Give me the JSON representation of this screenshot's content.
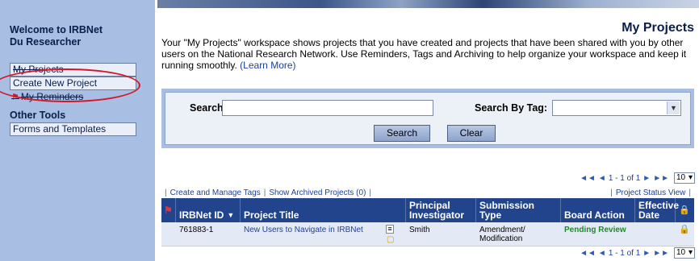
{
  "sidebar": {
    "welcome_line1": "Welcome to IRBNet",
    "welcome_line2": "Du Researcher",
    "items": [
      {
        "label": "My Projects"
      },
      {
        "label": "Create New Project"
      },
      {
        "label": "My Reminders"
      }
    ],
    "other_tools_heading": "Other Tools",
    "other_items": [
      {
        "label": "Forms and Templates"
      }
    ]
  },
  "main": {
    "title": "My Projects",
    "intro_text": "Your \"My Projects\" workspace shows projects that you have created and projects that have been shared with you by other users on the National Research Network. Use Reminders, Tags and Archiving to help organize your workspace and keep it running smoothly.",
    "learn_more": "(Learn More)"
  },
  "search": {
    "label": "Search:",
    "value": "",
    "tag_label": "Search By Tag:",
    "tag_value": "",
    "search_button": "Search",
    "clear_button": "Clear"
  },
  "pager": {
    "range": "1 - 1 of 1",
    "per_page": "10"
  },
  "links": {
    "manage_tags": "Create and Manage Tags",
    "archived": "Show Archived Projects (0)",
    "status_view": "Project Status View"
  },
  "table": {
    "headers": {
      "irbnet_id": "IRBNet ID",
      "project_title": "Project Title",
      "pi_line1": "Principal",
      "pi_line2": "Investigator",
      "sub_line1": "Submission",
      "sub_line2": "Type",
      "board_action": "Board Action",
      "eff_line1": "Effective",
      "eff_line2": "Date"
    },
    "rows": [
      {
        "id": "761883-1",
        "title": "New Users to Navigate in IRBNet",
        "pi": "Smith",
        "sub_line1": "Amendment/",
        "sub_line2": "Modification",
        "board_action": "Pending Review",
        "effective_date": ""
      }
    ]
  },
  "colors": {
    "sidebar_bg": "#a8bee3",
    "table_header": "#22448c",
    "link": "#1b3f9e",
    "pending": "#1e8a2a",
    "highlight_oval": "#d4182a"
  }
}
